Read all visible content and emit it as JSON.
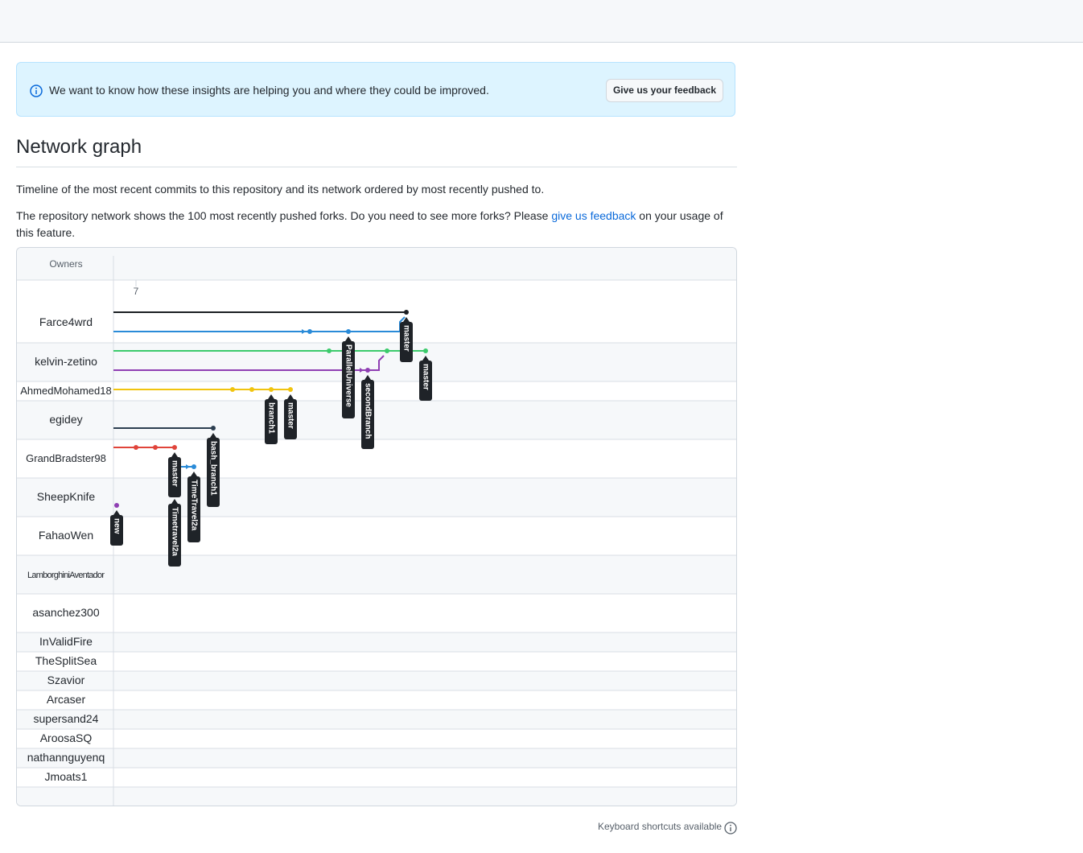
{
  "banner": {
    "message": "We want to know how these insights are helping you and where they could be improved.",
    "button_label": "Give us your feedback"
  },
  "page": {
    "title": "Network graph",
    "description": "Timeline of the most recent commits to this repository and its network ordered by most recently pushed to.",
    "forks_note_before": "The repository network shows the 100 most recently pushed forks. Do you need to see more forks? Please ",
    "forks_note_link": "give us feedback",
    "forks_note_after": " on your usage of this feature."
  },
  "graph": {
    "owners_header": "Owners",
    "date_label": "7",
    "owners": [
      "Farce4wrd",
      "kelvin-zetino",
      "AhmedMohamed18",
      "egidey",
      "GrandBradster98",
      "SheepKnife",
      "FahaoWen",
      "LamborghiniAventador",
      "asanchez300",
      "InValidFire",
      "TheSplitSea",
      "Szavior",
      "Arcaser",
      "supersand24",
      "AroosaSQ",
      "nathannguyenq",
      "Jmoats1"
    ],
    "colors": {
      "black": "#1b1f23",
      "blue": "#2a8bd8",
      "green": "#3ccb6c",
      "purple": "#8f3fb3",
      "yellow": "#f1c40f",
      "navy": "#2c3e50",
      "red": "#e0443a",
      "label_bg": "#1f2328"
    },
    "branches": [
      {
        "owner": "Farce4wrd",
        "label": "master"
      },
      {
        "owner": "Farce4wrd",
        "label": "ParallelUniverse"
      },
      {
        "owner": "kelvin-zetino",
        "label": "master"
      },
      {
        "owner": "kelvin-zetino",
        "label": "secondBranch"
      },
      {
        "owner": "AhmedMohamed18",
        "label": "branch1"
      },
      {
        "owner": "AhmedMohamed18",
        "label": "master"
      },
      {
        "owner": "egidey",
        "label": "bash_branch1"
      },
      {
        "owner": "GrandBradster98",
        "label": "master"
      },
      {
        "owner": "GrandBradster98",
        "label": "TimeTravel2a"
      },
      {
        "owner": "SheepKnife",
        "label": "Timetravel2a"
      },
      {
        "owner": "SheepKnife",
        "label": "new"
      }
    ]
  },
  "footer": {
    "shortcuts_text": "Keyboard shortcuts available"
  }
}
